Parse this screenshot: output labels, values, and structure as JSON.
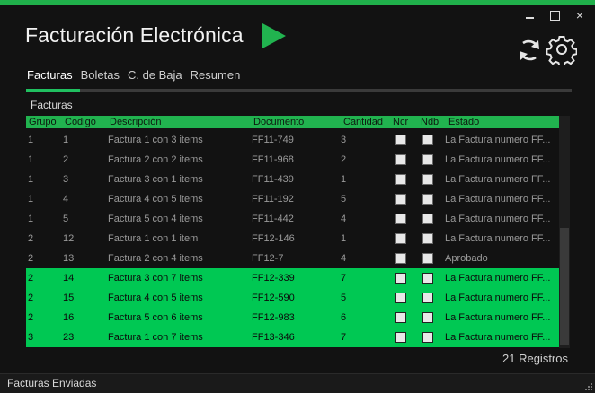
{
  "window": {
    "title": "Facturación Electrónica",
    "accent_color": "#20b04b",
    "controls": {
      "minimize": "minimize",
      "maximize": "maximize",
      "close": "×"
    }
  },
  "toolbar": {
    "run_icon": "play-icon",
    "refresh_icon": "refresh-icon",
    "settings_icon": "gear-icon"
  },
  "tabs": [
    {
      "label": "Facturas",
      "active": true
    },
    {
      "label": "Boletas",
      "active": false
    },
    {
      "label": "C. de Baja",
      "active": false
    },
    {
      "label": "Resumen",
      "active": false
    }
  ],
  "section": {
    "label": "Facturas"
  },
  "grid": {
    "columns": [
      "Grupo",
      "Codigo",
      "Descripción",
      "Documento",
      "Cantidad",
      "Ncr",
      "Ndb",
      "Estado"
    ],
    "rows": [
      {
        "grupo": "1",
        "codigo": "1",
        "descripcion": "Factura 1 con 3 items",
        "documento": "FF11-749",
        "cantidad": "3",
        "ncr": false,
        "ndb": false,
        "estado": "La Factura numero FF...",
        "selected": false
      },
      {
        "grupo": "1",
        "codigo": "2",
        "descripcion": "Factura 2 con 2 items",
        "documento": "FF11-968",
        "cantidad": "2",
        "ncr": false,
        "ndb": false,
        "estado": "La Factura numero FF...",
        "selected": false
      },
      {
        "grupo": "1",
        "codigo": "3",
        "descripcion": "Factura 3 con 1 items",
        "documento": "FF11-439",
        "cantidad": "1",
        "ncr": false,
        "ndb": false,
        "estado": "La Factura numero FF...",
        "selected": false
      },
      {
        "grupo": "1",
        "codigo": "4",
        "descripcion": "Factura 4 con 5 items",
        "documento": "FF11-192",
        "cantidad": "5",
        "ncr": false,
        "ndb": false,
        "estado": "La Factura numero FF...",
        "selected": false
      },
      {
        "grupo": "1",
        "codigo": "5",
        "descripcion": "Factura 5 con 4 items",
        "documento": "FF11-442",
        "cantidad": "4",
        "ncr": false,
        "ndb": false,
        "estado": "La Factura numero FF...",
        "selected": false
      },
      {
        "grupo": "2",
        "codigo": "12",
        "descripcion": "Factura 1 con 1 item",
        "documento": "FF12-146",
        "cantidad": "1",
        "ncr": false,
        "ndb": false,
        "estado": "La Factura numero FF...",
        "selected": false
      },
      {
        "grupo": "2",
        "codigo": "13",
        "descripcion": "Factura 2 con 4 items",
        "documento": "FF12-7",
        "cantidad": "4",
        "ncr": false,
        "ndb": false,
        "estado": "Aprobado",
        "selected": false
      },
      {
        "grupo": "2",
        "codigo": "14",
        "descripcion": "Factura 3 con 7 items",
        "documento": "FF12-339",
        "cantidad": "7",
        "ncr": false,
        "ndb": false,
        "estado": "La Factura numero FF...",
        "selected": true
      },
      {
        "grupo": "2",
        "codigo": "15",
        "descripcion": "Factura 4 con 5 items",
        "documento": "FF12-590",
        "cantidad": "5",
        "ncr": false,
        "ndb": false,
        "estado": "La Factura numero FF...",
        "selected": true
      },
      {
        "grupo": "2",
        "codigo": "16",
        "descripcion": "Factura 5 con 6 items",
        "documento": "FF12-983",
        "cantidad": "6",
        "ncr": false,
        "ndb": false,
        "estado": "La Factura numero FF...",
        "selected": true
      },
      {
        "grupo": "3",
        "codigo": "23",
        "descripcion": "Factura 1 con 7 items",
        "documento": "FF13-346",
        "cantidad": "7",
        "ncr": false,
        "ndb": false,
        "estado": "La Factura numero FF...",
        "selected": true
      }
    ]
  },
  "footer": {
    "records": "21 Registros",
    "status": "Facturas Enviadas"
  }
}
